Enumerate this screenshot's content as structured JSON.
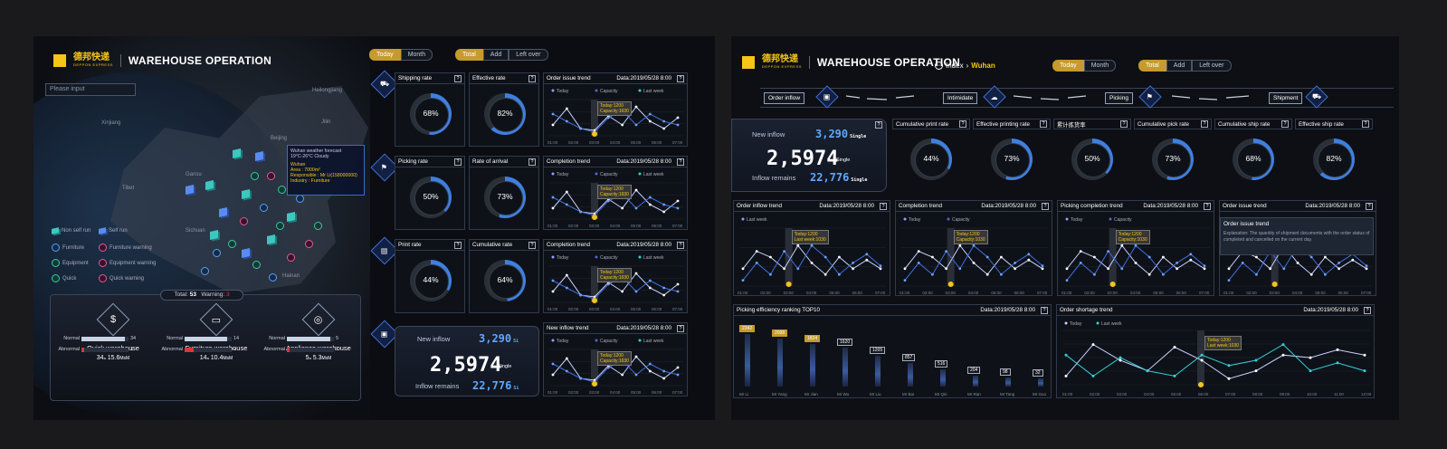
{
  "left": {
    "brand_cn": "德邦快递",
    "brand_en": "DEPPON EXPRESS",
    "title": "WAREHOUSE OPERATION",
    "search_placeholder": "Please input",
    "cities": [
      "Heilongjiang",
      "Jilin",
      "Beijing",
      "Xinjiang",
      "Gansu",
      "Tibet",
      "Sichuan",
      "Hainan"
    ],
    "popup": {
      "title": "Wuhan weather forecast",
      "weather": "19°C-26°C Cloudy",
      "city": "Wuhan",
      "area": "Area : 7000m²",
      "resp": "Responsible : Mr Li(158000000)",
      "industry": "Industry : Furniture"
    },
    "legend": [
      "Non self run",
      "Self run",
      "Furniture",
      "Furniture warning",
      "Equipment",
      "Equipment warning",
      "Quick",
      "Quick warning"
    ],
    "total_label": "Total:",
    "total": "53",
    "warn_label": "Warning:",
    "warning": "3",
    "warehouses": [
      {
        "name": "Quick warehouse",
        "count": "34",
        "area": "15.6",
        "normal": "34",
        "abnormal": "1",
        "icon": "$",
        "normal_frac": 0.92,
        "abn_frac": 0.05
      },
      {
        "name": "Furniture warehouse",
        "count": "14",
        "area": "10.4",
        "normal": "14",
        "abnormal": "2",
        "icon": "▭",
        "normal_frac": 0.9,
        "abn_frac": 0.2
      },
      {
        "name": "Appliance warehouse",
        "count": "5",
        "area": "5.3",
        "normal": "5",
        "abnormal": "1",
        "icon": "◎",
        "normal_frac": 0.92,
        "abn_frac": 0.05
      }
    ],
    "unit_count": "a",
    "unit_area": "MsM",
    "normal_label": "Normal",
    "abnormal_label": "Abnormal",
    "tabs1": [
      "Today",
      "Month"
    ],
    "tabs2": [
      "Total",
      "Add",
      "Left over"
    ],
    "rows": [
      {
        "g1": "Shipping rate",
        "v1": "68%",
        "p1": 0.68,
        "g2": "Effective rate",
        "v2": "82%",
        "p2": 0.82,
        "trend": "Order issue trend"
      },
      {
        "g1": "Picking rate",
        "v1": "50%",
        "p1": 0.5,
        "g2": "Rate of arrival",
        "v2": "73%",
        "p2": 0.73,
        "trend": "Completion trend"
      },
      {
        "g1": "Print rate",
        "v1": "44%",
        "p1": 0.44,
        "g2": "Cumulative rate",
        "v2": "64%",
        "p2": 0.64,
        "trend": "Completion trend"
      }
    ],
    "trend4": "New inflow trend",
    "date": "Data:2019/05/28 8:00",
    "legend_today": "Today",
    "legend_capacity": "Capacity",
    "legend_lastweek": "Last week",
    "tip1": "Today:1200",
    "tip2": "Capacity:1030",
    "inflow": {
      "new_label": "New inflow",
      "new": "3,290",
      "big": "2,5974",
      "remains_label": "Inflow remains",
      "remains": "22,776",
      "unit": "Single",
      "unit_short": "Si"
    }
  },
  "right": {
    "brand_cn": "德邦快递",
    "brand_en": "DEPPON EXPRESS",
    "title": "WAREHOUSE OPERATION",
    "crumb_index": "Index",
    "crumb_city": "Wuhan",
    "tabs1": [
      "Today",
      "Month"
    ],
    "tabs2": [
      "Total",
      "Add",
      "Left over"
    ],
    "flow": [
      "Order inflow",
      "Intimidate",
      "Picking",
      "Shipment"
    ],
    "inflow": {
      "new_label": "New inflow",
      "new": "3,290",
      "big": "2,5974",
      "remains_label": "Inflow remains",
      "remains": "22,776",
      "unit": "Single"
    },
    "gauges": [
      {
        "label": "Cumulative print rate",
        "v": "44%",
        "p": 0.44
      },
      {
        "label": "Effective printing rate",
        "v": "73%",
        "p": 0.73
      },
      {
        "label": "累计拣货率",
        "v": "50%",
        "p": 0.5
      },
      {
        "label": "Cumulative pick rate",
        "v": "73%",
        "p": 0.73
      },
      {
        "label": "Cumulative ship rate",
        "v": "68%",
        "p": 0.68
      },
      {
        "label": "Effective ship rate",
        "v": "82%",
        "p": 0.82
      }
    ],
    "trends": [
      "Order inflow trend",
      "Completion trend",
      "Picking completion trend",
      "Order issue trend"
    ],
    "date": "Data:2019/05/28 8:00",
    "explain_title": "Order issue trend",
    "explain_text": "Explanation: The quantity of shipment documents with the order status of completed and cancelled on the current day.",
    "tipA": "Today:1200",
    "tipB": "Last week:1030",
    "tipC": "Capacity:1030",
    "legend_today": "Today",
    "legend_lastweek": "Last week",
    "legend_capacity": "Capacity",
    "ranking_title": "Picking efficiency ranking TOP10",
    "shortage_title": "Order shortage trend",
    "ranking": [
      {
        "name": "Mr Li",
        "v": "2342",
        "n": 2342
      },
      {
        "name": "Mr Yang",
        "v": "2098",
        "n": 2098
      },
      {
        "name": "Mr Jian",
        "v": "1824",
        "n": 1824
      },
      {
        "name": "Mr Wu",
        "v": "1620",
        "n": 1620
      },
      {
        "name": "Mr Liu",
        "v": "1205",
        "n": 1205
      },
      {
        "name": "Mr Bai",
        "v": "857",
        "n": 857
      },
      {
        "name": "Mr Qin",
        "v": "516",
        "n": 516
      },
      {
        "name": "Mr Ran",
        "v": "204",
        "n": 204
      },
      {
        "name": "Mr Tang",
        "v": "98",
        "n": 98
      },
      {
        "name": "Mr Guo",
        "v": "32",
        "n": 32
      }
    ],
    "shortage_x": [
      "01:00",
      "02:00",
      "03:00",
      "04:00",
      "05:00",
      "06:00",
      "07:00",
      "08:00",
      "09:00",
      "10:00",
      "11:00",
      "12:00"
    ]
  },
  "small_x": [
    "01:00",
    "02:00",
    "03:00",
    "04:00",
    "05:00",
    "06:00",
    "07:00"
  ],
  "colors": {
    "accent": "#c69a2c",
    "blue": "#3f7fe0",
    "cyan": "#35d0d8",
    "bg": "#0b0d12"
  }
}
